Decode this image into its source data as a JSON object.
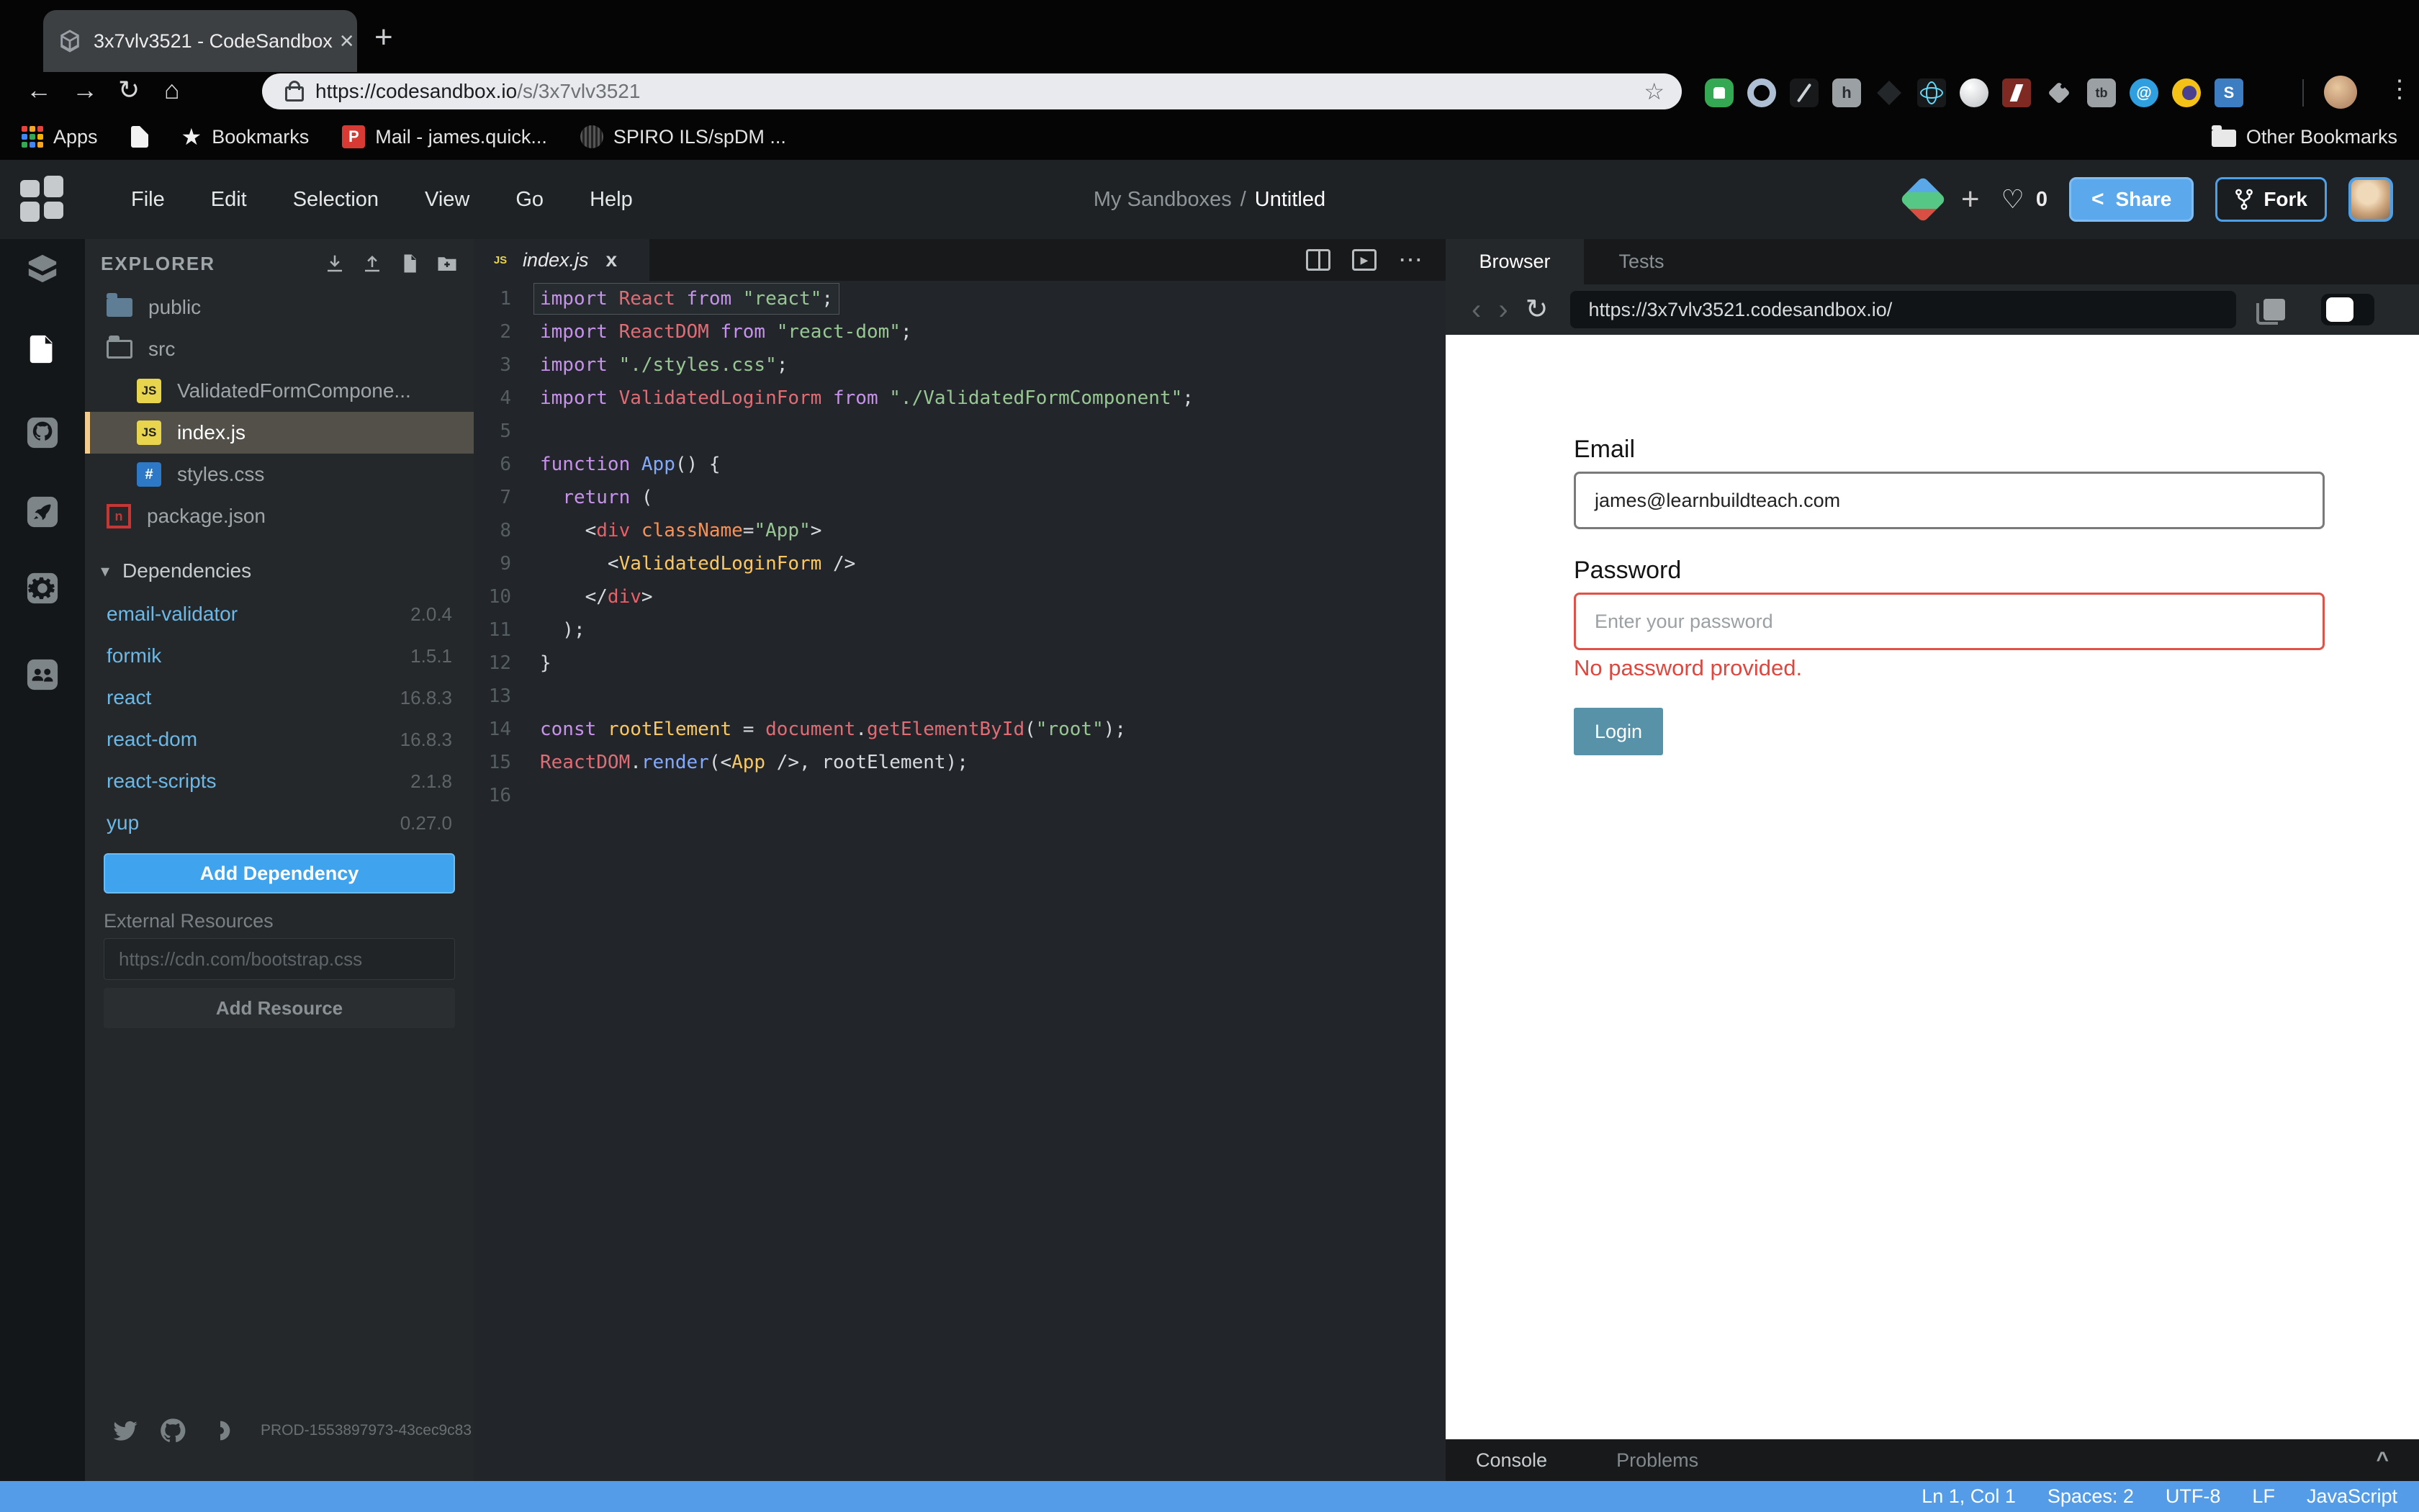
{
  "colors": {
    "accent_blue": "#3fa3ee",
    "statusbar_blue": "#549ce8",
    "error_red": "#e0463e",
    "login_teal": "#5792a9",
    "select_yellow": "#f2cc8f"
  },
  "chrome": {
    "tab_title": "3x7vlv3521 - CodeSandbox",
    "url_prefix": "https://codesandbox.io",
    "url_path": "/s/3x7vlv3521",
    "bookmarks": {
      "apps": "Apps",
      "bookmarks": "Bookmarks",
      "mail": "Mail - james.quick...",
      "mail_initial": "P",
      "spiro": "SPIRO ILS/spDM ...",
      "other": "Other Bookmarks"
    },
    "extensions": [
      {
        "kind": "thumb"
      },
      {
        "kind": "donut"
      },
      {
        "kind": "pen"
      },
      {
        "kind": "h",
        "label": "h"
      },
      {
        "kind": "diamond"
      },
      {
        "kind": "react"
      },
      {
        "kind": "sphere"
      },
      {
        "kind": "flash"
      },
      {
        "kind": "tag"
      },
      {
        "kind": "tb",
        "label": "tb"
      },
      {
        "kind": "at",
        "label": "@"
      },
      {
        "kind": "moon"
      },
      {
        "kind": "s",
        "label": "S"
      }
    ]
  },
  "header": {
    "menus": [
      "File",
      "Edit",
      "Selection",
      "View",
      "Go",
      "Help"
    ],
    "breadcrumb_parent": "My Sandboxes",
    "breadcrumb_sep": "/",
    "breadcrumb_current": "Untitled",
    "like_count": "0",
    "share_label": "Share",
    "fork_label": "Fork"
  },
  "explorer": {
    "title": "EXPLORER",
    "files": [
      {
        "name": "public"
      },
      {
        "name": "src"
      },
      {
        "name": "ValidatedFormCompone..."
      },
      {
        "name": "index.js"
      },
      {
        "name": "styles.css"
      },
      {
        "name": "package.json"
      }
    ],
    "deps_title": "Dependencies",
    "dependencies": [
      {
        "name": "email-validator",
        "version": "2.0.4"
      },
      {
        "name": "formik",
        "version": "1.5.1"
      },
      {
        "name": "react",
        "version": "16.8.3"
      },
      {
        "name": "react-dom",
        "version": "16.8.3"
      },
      {
        "name": "react-scripts",
        "version": "2.1.8"
      },
      {
        "name": "yup",
        "version": "0.27.0"
      }
    ],
    "add_dependency": "Add Dependency",
    "external_resources": "External Resources",
    "resource_placeholder": "https://cdn.com/bootstrap.css",
    "add_resource": "Add Resource",
    "build_id": "PROD-1553897973-43cec9c83"
  },
  "editor": {
    "tab": "index.js",
    "badge": "JS",
    "lines": [
      [
        [
          "kw",
          "import"
        ],
        [
          "pl",
          " "
        ],
        [
          "id",
          "React"
        ],
        [
          "pl",
          " "
        ],
        [
          "kw",
          "from"
        ],
        [
          "pl",
          " "
        ],
        [
          "str",
          "\"react\""
        ],
        [
          "pl",
          ";"
        ]
      ],
      [
        [
          "kw",
          "import"
        ],
        [
          "pl",
          " "
        ],
        [
          "id",
          "ReactDOM"
        ],
        [
          "pl",
          " "
        ],
        [
          "kw",
          "from"
        ],
        [
          "pl",
          " "
        ],
        [
          "str",
          "\"react-dom\""
        ],
        [
          "pl",
          ";"
        ]
      ],
      [
        [
          "kw",
          "import"
        ],
        [
          "pl",
          " "
        ],
        [
          "str",
          "\"./styles.css\""
        ],
        [
          "pl",
          ";"
        ]
      ],
      [
        [
          "kw",
          "import"
        ],
        [
          "pl",
          " "
        ],
        [
          "id",
          "ValidatedLoginForm"
        ],
        [
          "pl",
          " "
        ],
        [
          "kw",
          "from"
        ],
        [
          "pl",
          " "
        ],
        [
          "str",
          "\"./ValidatedFormComponent\""
        ],
        [
          "pl",
          ";"
        ]
      ],
      [],
      [
        [
          "kw",
          "function"
        ],
        [
          "pl",
          " "
        ],
        [
          "fn",
          "App"
        ],
        [
          "pl",
          "() {"
        ]
      ],
      [
        [
          "pl",
          "  "
        ],
        [
          "kw",
          "return"
        ],
        [
          "pl",
          " ("
        ]
      ],
      [
        [
          "pl",
          "    <"
        ],
        [
          "tag",
          "div"
        ],
        [
          "pl",
          " "
        ],
        [
          "attr",
          "className"
        ],
        [
          "pl",
          "="
        ],
        [
          "str",
          "\"App\""
        ],
        [
          "pl",
          ">"
        ]
      ],
      [
        [
          "pl",
          "      <"
        ],
        [
          "comp",
          "ValidatedLoginForm"
        ],
        [
          "pl",
          " />"
        ]
      ],
      [
        [
          "pl",
          "    </"
        ],
        [
          "tag",
          "div"
        ],
        [
          "pl",
          ">"
        ]
      ],
      [
        [
          "pl",
          "  );"
        ]
      ],
      [
        [
          "pl",
          "}"
        ]
      ],
      [],
      [
        [
          "kw",
          "const"
        ],
        [
          "pl",
          " "
        ],
        [
          "comp",
          "rootElement"
        ],
        [
          "pl",
          " = "
        ],
        [
          "id",
          "document"
        ],
        [
          "pl",
          "."
        ],
        [
          "id",
          "getElementById"
        ],
        [
          "pl",
          "("
        ],
        [
          "str",
          "\"root\""
        ],
        [
          "pl",
          ");"
        ]
      ],
      [
        [
          "id",
          "ReactDOM"
        ],
        [
          "pl",
          "."
        ],
        [
          "fn",
          "render"
        ],
        [
          "pl",
          "(<"
        ],
        [
          "comp",
          "App"
        ],
        [
          "pl",
          " />, rootElement);"
        ]
      ],
      []
    ]
  },
  "preview": {
    "tab_browser": "Browser",
    "tab_tests": "Tests",
    "url": "https://3x7vlv3521.codesandbox.io/",
    "form": {
      "email_label": "Email",
      "email_value": "james@learnbuildteach.com",
      "password_label": "Password",
      "password_placeholder": "Enter your password",
      "error": "No password provided.",
      "login_label": "Login"
    }
  },
  "console_bar": {
    "console": "Console",
    "problems": "Problems"
  },
  "status_bar": {
    "items": [
      "Ln 1, Col 1",
      "Spaces: 2",
      "UTF-8",
      "LF",
      "JavaScript"
    ]
  }
}
